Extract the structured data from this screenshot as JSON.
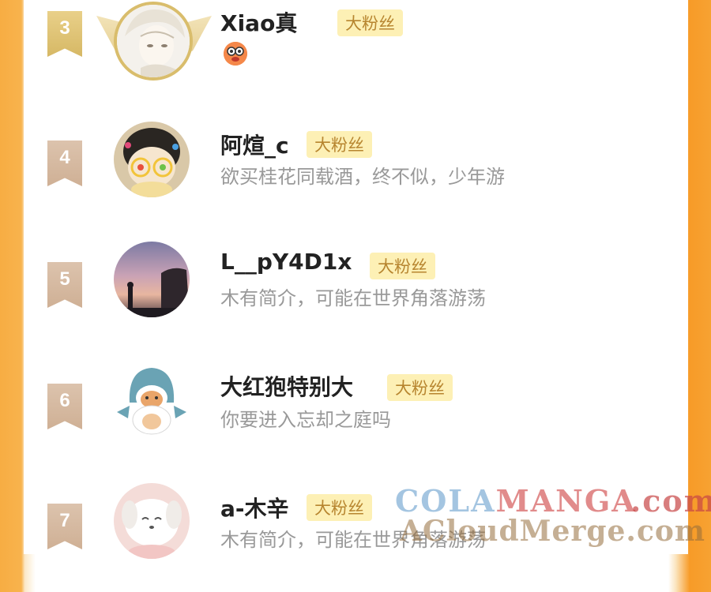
{
  "fans": [
    {
      "rank": "3",
      "name": "Xiao真",
      "badge": "大粉丝",
      "bio": "",
      "emoji": "glasses-face-emoji",
      "avatar": "anime-boy-avatar",
      "tier": "gold"
    },
    {
      "rank": "4",
      "name": "阿煊_c",
      "badge": "大粉丝",
      "bio": "欲买桂花同载酒，终不似，少年游",
      "avatar": "plush-doll-avatar",
      "tier": "bronze"
    },
    {
      "rank": "5",
      "name": "L__pY4D1x",
      "badge": "大粉丝",
      "bio": "木有简介，可能在世界角落游荡",
      "avatar": "sunset-silhouette-avatar",
      "tier": "bronze"
    },
    {
      "rank": "6",
      "name": "大红狍特别大",
      "badge": "大粉丝",
      "bio": "你要进入忘却之庭吗",
      "avatar": "shark-cat-avatar",
      "tier": "bronze"
    },
    {
      "rank": "7",
      "name": "a-木辛",
      "badge": "大粉丝",
      "bio": "木有简介，可能在世界角落游荡",
      "avatar": "white-dog-avatar",
      "tier": "bronze"
    }
  ],
  "watermark": {
    "line1_a": "COLA",
    "line1_b": "MANGA",
    "line1_c": ".com",
    "line2": "ACloudMerge.com"
  },
  "colors": {
    "accent_orange": "#f79b28",
    "badge_bg": "#fdf0b5",
    "badge_text": "#b7852f",
    "gold": "#d9bd6c"
  }
}
